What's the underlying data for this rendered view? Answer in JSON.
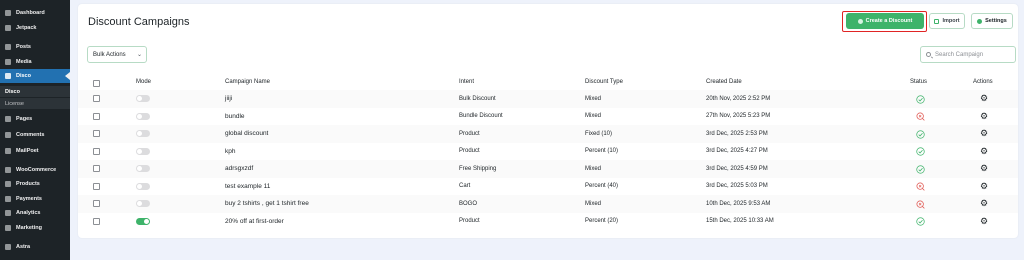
{
  "sidebar": {
    "items": [
      {
        "label": "Dashboard",
        "icon": "dashboard-icon"
      },
      {
        "label": "Jetpack",
        "icon": "jetpack-icon"
      },
      {
        "label": "Posts",
        "icon": "pin-icon"
      },
      {
        "label": "Media",
        "icon": "media-icon"
      },
      {
        "label": "Disco",
        "icon": "disco-icon",
        "active": true
      },
      {
        "label": "Pages",
        "icon": "pages-icon"
      },
      {
        "label": "Comments",
        "icon": "comments-icon"
      },
      {
        "label": "MailPoet",
        "icon": "mailpoet-icon"
      },
      {
        "label": "WooCommerce",
        "icon": "woocommerce-icon"
      },
      {
        "label": "Products",
        "icon": "products-icon"
      },
      {
        "label": "Payments",
        "icon": "payments-icon"
      },
      {
        "label": "Analytics",
        "icon": "analytics-icon"
      },
      {
        "label": "Marketing",
        "icon": "marketing-icon"
      },
      {
        "label": "Astra",
        "icon": "astra-icon"
      }
    ],
    "subitems": [
      {
        "label": "Disco",
        "current": true
      },
      {
        "label": "License",
        "current": false
      }
    ]
  },
  "page": {
    "title": "Discount Campaigns",
    "create_label": "Create a Discount",
    "import_label": "Import",
    "settings_label": "Settings",
    "bulk_label": "Bulk Actions",
    "search_placeholder": "Search Campaign"
  },
  "table": {
    "headers": {
      "mode": "Mode",
      "name": "Campaign Name",
      "intent": "Intent",
      "type": "Discount Type",
      "date": "Created Date",
      "status": "Status",
      "actions": "Actions"
    },
    "rows": [
      {
        "mode": false,
        "name": "jiiji",
        "intent": "Bulk Discount",
        "type": "Mixed",
        "date": "20th Nov, 2025 2:52 PM",
        "status": "active"
      },
      {
        "mode": false,
        "name": "bundle",
        "intent": "Bundle Discount",
        "type": "Mixed",
        "date": "27th Nov, 2025 5:23 PM",
        "status": "inactive"
      },
      {
        "mode": false,
        "name": "global discount",
        "intent": "Product",
        "type": "Fixed (10)",
        "date": "3rd Dec, 2025 2:53 PM",
        "status": "active"
      },
      {
        "mode": false,
        "name": "kph",
        "intent": "Product",
        "type": "Percent (10)",
        "date": "3rd Dec, 2025 4:27 PM",
        "status": "active"
      },
      {
        "mode": false,
        "name": "adrsgxzdf",
        "intent": "Free Shipping",
        "type": "Mixed",
        "date": "3rd Dec, 2025 4:59 PM",
        "status": "active"
      },
      {
        "mode": false,
        "name": "test example 11",
        "intent": "Cart",
        "type": "Percent (40)",
        "date": "3rd Dec, 2025 5:03 PM",
        "status": "inactive"
      },
      {
        "mode": false,
        "name": "buy 2 tshirts , get 1 tshirt free",
        "intent": "BOGO",
        "type": "Mixed",
        "date": "10th Dec, 2025 9:53 AM",
        "status": "inactive"
      },
      {
        "mode": true,
        "name": "20% off at first-order",
        "intent": "Product",
        "type": "Percent (20)",
        "date": "15th Dec, 2025 10:33 AM",
        "status": "active"
      }
    ]
  },
  "colors": {
    "accent_green": "#3eb36a",
    "status_active": "#3eb36a",
    "status_inactive": "#e0554f",
    "sidebar_bg": "#1d2327",
    "sidebar_active": "#2271b1",
    "highlight_frame": "#e02424"
  }
}
